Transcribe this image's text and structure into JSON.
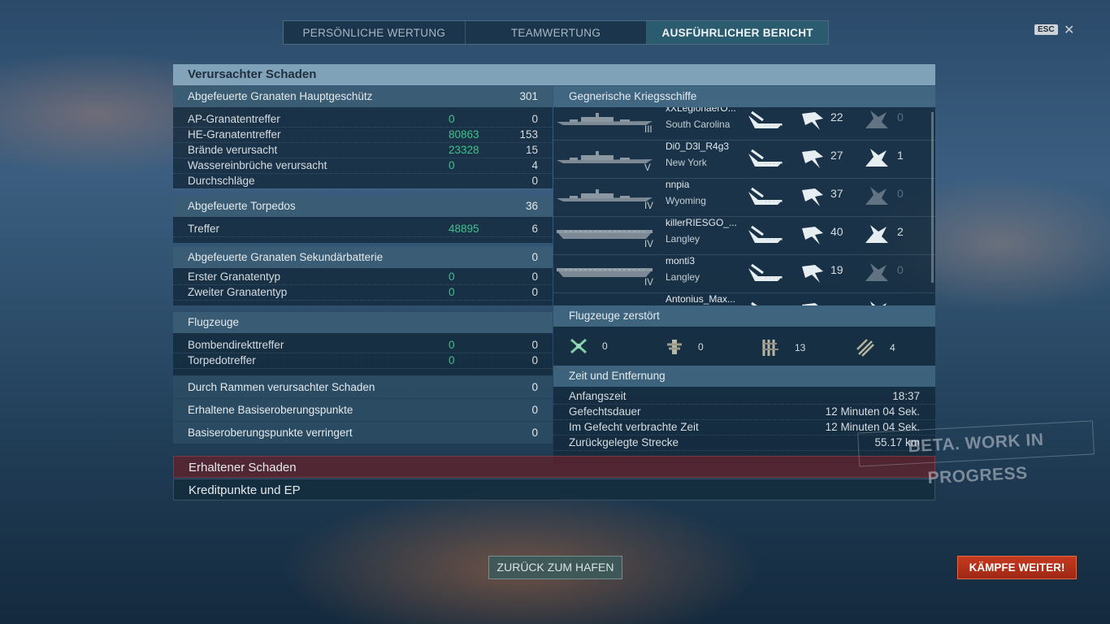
{
  "tabs": [
    "PERSÖNLICHE WERTUNG",
    "TEAMWERTUNG",
    "AUSFÜHRLICHER BERICHT"
  ],
  "esc_label": "ESC",
  "close_glyph": "✕",
  "panel_title": "Verursachter Schaden",
  "main_battery": {
    "header": "Abgefeuerte Granaten Hauptgeschütz",
    "header_value": "301",
    "rows": [
      {
        "label": "AP-Granatentreffer",
        "damage": "0",
        "value": "0"
      },
      {
        "label": "HE-Granatentreffer",
        "damage": "80863",
        "value": "153"
      },
      {
        "label": "Brände verursacht",
        "damage": "23328",
        "value": "15"
      },
      {
        "label": "Wassereinbrüche verursacht",
        "damage": "0",
        "value": "4"
      },
      {
        "label": "Durchschläge",
        "damage": "",
        "value": "0"
      }
    ]
  },
  "torpedoes": {
    "header": "Abgefeuerte Torpedos",
    "header_value": "36",
    "rows": [
      {
        "label": "Treffer",
        "damage": "48895",
        "value": "6"
      }
    ]
  },
  "secondary": {
    "header": "Abgefeuerte Granaten Sekundärbatterie",
    "header_value": "0",
    "rows": [
      {
        "label": "Erster Granatentyp",
        "damage": "0",
        "value": "0"
      },
      {
        "label": "Zweiter Granatentyp",
        "damage": "0",
        "value": "0"
      }
    ]
  },
  "aircraft": {
    "header": "Flugzeuge",
    "rows": [
      {
        "label": "Bombendirekttreffer",
        "damage": "0",
        "value": "0"
      },
      {
        "label": "Torpedotreffer",
        "damage": "0",
        "value": "0"
      }
    ]
  },
  "ramming": {
    "label": "Durch Rammen verursachter Schaden",
    "value": "0"
  },
  "base_cap": {
    "label": "Erhaltene Basiseroberungspunkte",
    "value": "0"
  },
  "base_reduce": {
    "label": "Basiseroberungspunkte verringert",
    "value": "0"
  },
  "enemy_ships": {
    "header": "Gegnerische Kriegsschiffe",
    "ships": [
      {
        "player": "xXLegionaerO...",
        "tier": "III",
        "ship": "South Carolina",
        "hits": "22",
        "sunk": "0"
      },
      {
        "player": "Di0_D3l_R4g3",
        "tier": "V",
        "ship": "New York",
        "hits": "27",
        "sunk": "1"
      },
      {
        "player": "nnpia",
        "tier": "IV",
        "ship": "Wyoming",
        "hits": "37",
        "sunk": "0"
      },
      {
        "player": "killerRIESGO_...",
        "tier": "IV",
        "ship": "Langley",
        "hits": "40",
        "sunk": "2"
      },
      {
        "player": "monti3",
        "tier": "IV",
        "ship": "Langley",
        "hits": "19",
        "sunk": "0"
      },
      {
        "player": "Antonius_Max...",
        "tier": "",
        "ship": "",
        "hits": "",
        "sunk": ""
      }
    ]
  },
  "planes_destroyed": {
    "header": "Flugzeuge zerstört",
    "counts": [
      "0",
      "0",
      "13",
      "4"
    ]
  },
  "time_distance": {
    "header": "Zeit und Entfernung",
    "rows": [
      {
        "label": "Anfangszeit",
        "value": "18:37"
      },
      {
        "label": "Gefechtsdauer",
        "value": "12 Minuten 04 Sek."
      },
      {
        "label": "Im Gefecht verbrachte Zeit",
        "value": "12 Minuten 04 Sek."
      },
      {
        "label": "Zurückgelegte Strecke",
        "value": "55.17 km"
      }
    ]
  },
  "received_damage": "Erhaltener Schaden",
  "credits_xp": "Kreditpunkte und EP",
  "watermark": "BETA. WORK IN PROGRESS",
  "back_button": "ZURÜCK ZUM HAFEN",
  "fight_button": "KÄMPFE WEITER!"
}
